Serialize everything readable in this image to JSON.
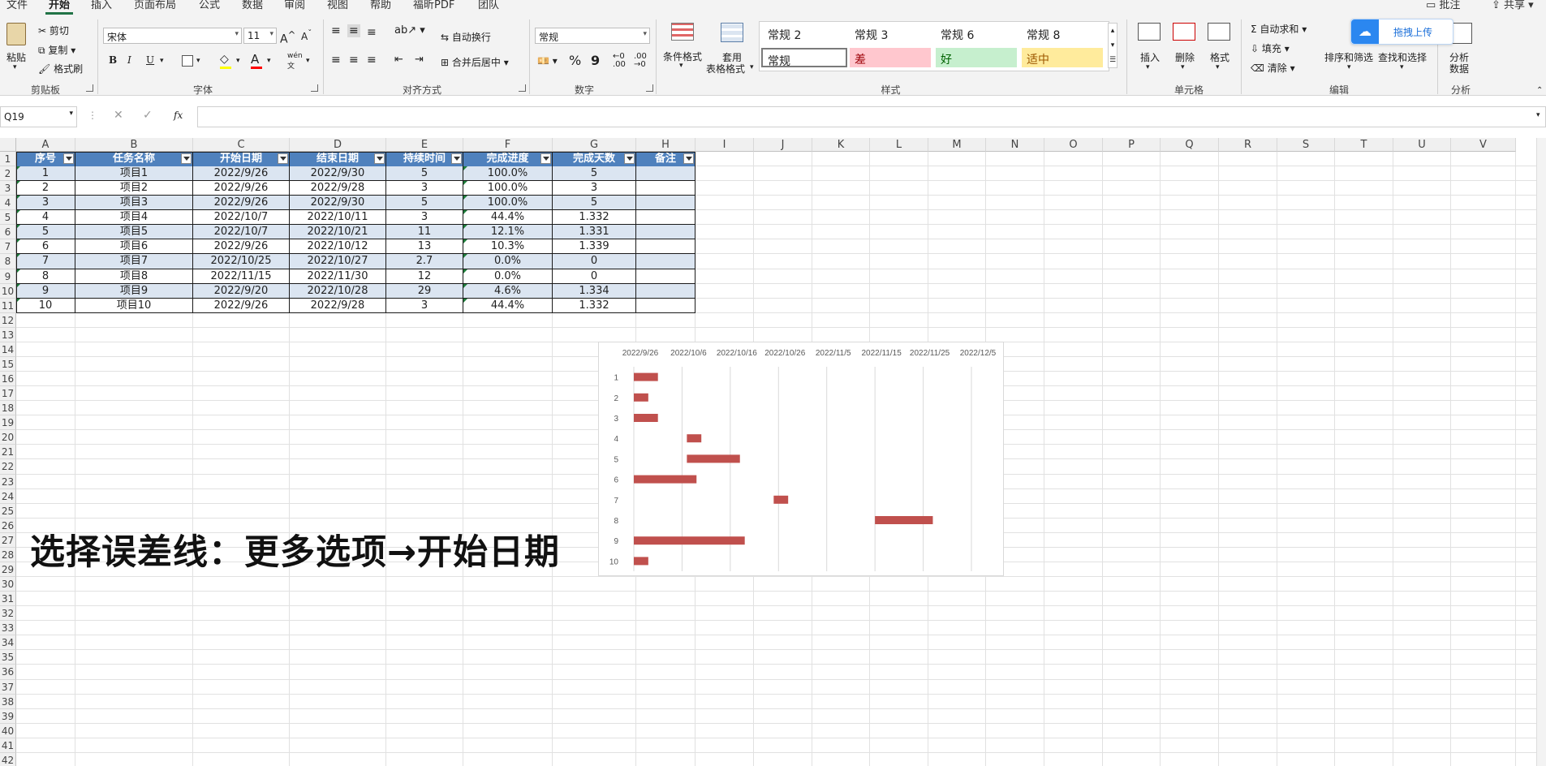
{
  "menu": {
    "tabs": [
      "文件",
      "开始",
      "插入",
      "页面布局",
      "公式",
      "数据",
      "审阅",
      "视图",
      "帮助",
      "福昕PDF",
      "团队"
    ],
    "right": [
      "批注",
      "共享"
    ]
  },
  "ribbon": {
    "clipboard": {
      "paste": "粘贴",
      "cut": "剪切",
      "copy": "复制",
      "format_painter": "格式刷",
      "label": "剪贴板"
    },
    "font": {
      "name": "宋体",
      "size": "11",
      "label": "字体",
      "bold": "B",
      "italic": "I",
      "underline": "U",
      "font_color_letter": "A",
      "wen": "wén"
    },
    "alignment": {
      "wrap": "自动换行",
      "merge": "合并后居中",
      "label": "对齐方式"
    },
    "number": {
      "format": "常规",
      "label": "数字",
      "percent": "%",
      "comma": "9"
    },
    "styles": {
      "conditional": "条件格式",
      "table_format_1": "套用",
      "table_format_2": "表格格式",
      "cells": [
        "常规 2",
        "常规 3",
        "常规 6",
        "常规 8",
        "常规",
        "差",
        "好",
        "适中"
      ],
      "label": "样式"
    },
    "cells": {
      "insert": "插入",
      "delete": "删除",
      "format": "格式",
      "label": "单元格"
    },
    "editing": {
      "autosum": "自动求和",
      "fill": "填充",
      "clear": "清除",
      "sort_filter": "排序和筛选",
      "find_select": "查找和选择",
      "label": "编辑"
    },
    "analysis": {
      "analyze_1": "分析",
      "analyze_2": "数据",
      "label": "分析"
    },
    "upload": "拖拽上传"
  },
  "formula_bar": {
    "name_box": "Q19",
    "fx": "fx",
    "value": ""
  },
  "columns": [
    "A",
    "B",
    "C",
    "D",
    "E",
    "F",
    "G",
    "H",
    "I",
    "J",
    "K",
    "L",
    "M",
    "N",
    "O",
    "P",
    "Q",
    "R",
    "S",
    "T",
    "U",
    "V"
  ],
  "rows": [
    "1",
    "2",
    "3",
    "4",
    "5",
    "6",
    "7",
    "8",
    "9",
    "10",
    "11",
    "12",
    "13",
    "14",
    "15",
    "16",
    "17",
    "18",
    "19",
    "20",
    "21",
    "22",
    "23",
    "24",
    "25",
    "26",
    "27",
    "28",
    "29",
    "30",
    "31",
    "32",
    "33",
    "34",
    "35",
    "36",
    "37",
    "38",
    "39",
    "40",
    "41",
    "42"
  ],
  "table": {
    "headers": [
      "序号",
      "任务名称",
      "开始日期",
      "结束日期",
      "持续时间",
      "完成进度",
      "完成天数",
      "备注"
    ],
    "rows": [
      [
        "1",
        "项目1",
        "2022/9/26",
        "2022/9/30",
        "5",
        "100.0%",
        "5",
        ""
      ],
      [
        "2",
        "项目2",
        "2022/9/26",
        "2022/9/28",
        "3",
        "100.0%",
        "3",
        ""
      ],
      [
        "3",
        "项目3",
        "2022/9/26",
        "2022/9/30",
        "5",
        "100.0%",
        "5",
        ""
      ],
      [
        "4",
        "项目4",
        "2022/10/7",
        "2022/10/11",
        "3",
        "44.4%",
        "1.332",
        ""
      ],
      [
        "5",
        "项目5",
        "2022/10/7",
        "2022/10/21",
        "11",
        "12.1%",
        "1.331",
        ""
      ],
      [
        "6",
        "项目6",
        "2022/9/26",
        "2022/10/12",
        "13",
        "10.3%",
        "1.339",
        ""
      ],
      [
        "7",
        "项目7",
        "2022/10/25",
        "2022/10/27",
        "2.7",
        "0.0%",
        "0",
        ""
      ],
      [
        "8",
        "项目8",
        "2022/11/15",
        "2022/11/30",
        "12",
        "0.0%",
        "0",
        ""
      ],
      [
        "9",
        "项目9",
        "2022/9/20",
        "2022/10/28",
        "29",
        "4.6%",
        "1.334",
        ""
      ],
      [
        "10",
        "项目10",
        "2022/9/26",
        "2022/9/28",
        "3",
        "44.4%",
        "1.332",
        ""
      ]
    ]
  },
  "caption": "选择误差线：更多选项→开始日期",
  "chart_data": {
    "type": "bar",
    "orientation": "horizontal",
    "categories": [
      "1",
      "2",
      "3",
      "4",
      "5",
      "6",
      "7",
      "8",
      "9",
      "10"
    ],
    "x_ticks": [
      "2022/9/26",
      "2022/10/6",
      "2022/10/16",
      "2022/10/26",
      "2022/11/5",
      "2022/11/15",
      "2022/11/25",
      "2022/12/5"
    ],
    "x_axis_position": "top",
    "xlim": [
      "2022/9/26",
      "2022/12/5"
    ],
    "bars": [
      {
        "category": "1",
        "start": "2022/9/26",
        "end": "2022/10/1"
      },
      {
        "category": "2",
        "start": "2022/9/26",
        "end": "2022/9/29"
      },
      {
        "category": "3",
        "start": "2022/9/26",
        "end": "2022/10/1"
      },
      {
        "category": "4",
        "start": "2022/10/7",
        "end": "2022/10/10"
      },
      {
        "category": "5",
        "start": "2022/10/7",
        "end": "2022/10/18"
      },
      {
        "category": "6",
        "start": "2022/9/26",
        "end": "2022/10/9"
      },
      {
        "category": "7",
        "start": "2022/10/25",
        "end": "2022/10/28"
      },
      {
        "category": "8",
        "start": "2022/11/15",
        "end": "2022/11/27"
      },
      {
        "category": "9",
        "start": "2022/9/26",
        "end": "2022/10/19"
      },
      {
        "category": "10",
        "start": "2022/9/26",
        "end": "2022/9/29"
      }
    ],
    "bar_color": "#c0504d",
    "grid": true,
    "legend": "none"
  }
}
